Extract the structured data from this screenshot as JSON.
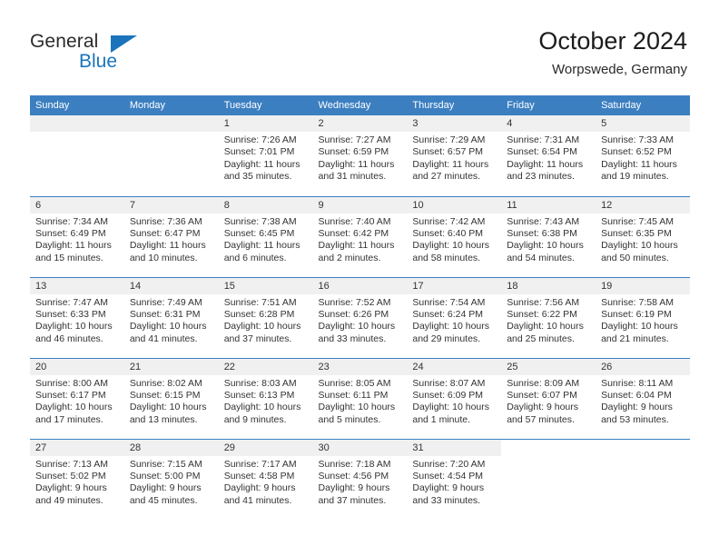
{
  "brand": {
    "name_part1": "General",
    "name_part2": "Blue",
    "logo_icon": "triangle-flag-icon",
    "accent_color": "#1b74bb"
  },
  "header": {
    "title": "October 2024",
    "location": "Worpswede, Germany"
  },
  "calendar": {
    "header_bg": "#3c7fc1",
    "daynum_bg": "#f0f0f0",
    "weekdays": [
      "Sunday",
      "Monday",
      "Tuesday",
      "Wednesday",
      "Thursday",
      "Friday",
      "Saturday"
    ],
    "weeks": [
      [
        {
          "day": "",
          "empty": true,
          "sunrise": "",
          "sunset": "",
          "daylight_l1": "",
          "daylight_l2": ""
        },
        {
          "day": "",
          "empty": true,
          "sunrise": "",
          "sunset": "",
          "daylight_l1": "",
          "daylight_l2": ""
        },
        {
          "day": "1",
          "sunrise": "Sunrise: 7:26 AM",
          "sunset": "Sunset: 7:01 PM",
          "daylight_l1": "Daylight: 11 hours",
          "daylight_l2": "and 35 minutes."
        },
        {
          "day": "2",
          "sunrise": "Sunrise: 7:27 AM",
          "sunset": "Sunset: 6:59 PM",
          "daylight_l1": "Daylight: 11 hours",
          "daylight_l2": "and 31 minutes."
        },
        {
          "day": "3",
          "sunrise": "Sunrise: 7:29 AM",
          "sunset": "Sunset: 6:57 PM",
          "daylight_l1": "Daylight: 11 hours",
          "daylight_l2": "and 27 minutes."
        },
        {
          "day": "4",
          "sunrise": "Sunrise: 7:31 AM",
          "sunset": "Sunset: 6:54 PM",
          "daylight_l1": "Daylight: 11 hours",
          "daylight_l2": "and 23 minutes."
        },
        {
          "day": "5",
          "sunrise": "Sunrise: 7:33 AM",
          "sunset": "Sunset: 6:52 PM",
          "daylight_l1": "Daylight: 11 hours",
          "daylight_l2": "and 19 minutes."
        }
      ],
      [
        {
          "day": "6",
          "sunrise": "Sunrise: 7:34 AM",
          "sunset": "Sunset: 6:49 PM",
          "daylight_l1": "Daylight: 11 hours",
          "daylight_l2": "and 15 minutes."
        },
        {
          "day": "7",
          "sunrise": "Sunrise: 7:36 AM",
          "sunset": "Sunset: 6:47 PM",
          "daylight_l1": "Daylight: 11 hours",
          "daylight_l2": "and 10 minutes."
        },
        {
          "day": "8",
          "sunrise": "Sunrise: 7:38 AM",
          "sunset": "Sunset: 6:45 PM",
          "daylight_l1": "Daylight: 11 hours",
          "daylight_l2": "and 6 minutes."
        },
        {
          "day": "9",
          "sunrise": "Sunrise: 7:40 AM",
          "sunset": "Sunset: 6:42 PM",
          "daylight_l1": "Daylight: 11 hours",
          "daylight_l2": "and 2 minutes."
        },
        {
          "day": "10",
          "sunrise": "Sunrise: 7:42 AM",
          "sunset": "Sunset: 6:40 PM",
          "daylight_l1": "Daylight: 10 hours",
          "daylight_l2": "and 58 minutes."
        },
        {
          "day": "11",
          "sunrise": "Sunrise: 7:43 AM",
          "sunset": "Sunset: 6:38 PM",
          "daylight_l1": "Daylight: 10 hours",
          "daylight_l2": "and 54 minutes."
        },
        {
          "day": "12",
          "sunrise": "Sunrise: 7:45 AM",
          "sunset": "Sunset: 6:35 PM",
          "daylight_l1": "Daylight: 10 hours",
          "daylight_l2": "and 50 minutes."
        }
      ],
      [
        {
          "day": "13",
          "sunrise": "Sunrise: 7:47 AM",
          "sunset": "Sunset: 6:33 PM",
          "daylight_l1": "Daylight: 10 hours",
          "daylight_l2": "and 46 minutes."
        },
        {
          "day": "14",
          "sunrise": "Sunrise: 7:49 AM",
          "sunset": "Sunset: 6:31 PM",
          "daylight_l1": "Daylight: 10 hours",
          "daylight_l2": "and 41 minutes."
        },
        {
          "day": "15",
          "sunrise": "Sunrise: 7:51 AM",
          "sunset": "Sunset: 6:28 PM",
          "daylight_l1": "Daylight: 10 hours",
          "daylight_l2": "and 37 minutes."
        },
        {
          "day": "16",
          "sunrise": "Sunrise: 7:52 AM",
          "sunset": "Sunset: 6:26 PM",
          "daylight_l1": "Daylight: 10 hours",
          "daylight_l2": "and 33 minutes."
        },
        {
          "day": "17",
          "sunrise": "Sunrise: 7:54 AM",
          "sunset": "Sunset: 6:24 PM",
          "daylight_l1": "Daylight: 10 hours",
          "daylight_l2": "and 29 minutes."
        },
        {
          "day": "18",
          "sunrise": "Sunrise: 7:56 AM",
          "sunset": "Sunset: 6:22 PM",
          "daylight_l1": "Daylight: 10 hours",
          "daylight_l2": "and 25 minutes."
        },
        {
          "day": "19",
          "sunrise": "Sunrise: 7:58 AM",
          "sunset": "Sunset: 6:19 PM",
          "daylight_l1": "Daylight: 10 hours",
          "daylight_l2": "and 21 minutes."
        }
      ],
      [
        {
          "day": "20",
          "sunrise": "Sunrise: 8:00 AM",
          "sunset": "Sunset: 6:17 PM",
          "daylight_l1": "Daylight: 10 hours",
          "daylight_l2": "and 17 minutes."
        },
        {
          "day": "21",
          "sunrise": "Sunrise: 8:02 AM",
          "sunset": "Sunset: 6:15 PM",
          "daylight_l1": "Daylight: 10 hours",
          "daylight_l2": "and 13 minutes."
        },
        {
          "day": "22",
          "sunrise": "Sunrise: 8:03 AM",
          "sunset": "Sunset: 6:13 PM",
          "daylight_l1": "Daylight: 10 hours",
          "daylight_l2": "and 9 minutes."
        },
        {
          "day": "23",
          "sunrise": "Sunrise: 8:05 AM",
          "sunset": "Sunset: 6:11 PM",
          "daylight_l1": "Daylight: 10 hours",
          "daylight_l2": "and 5 minutes."
        },
        {
          "day": "24",
          "sunrise": "Sunrise: 8:07 AM",
          "sunset": "Sunset: 6:09 PM",
          "daylight_l1": "Daylight: 10 hours",
          "daylight_l2": "and 1 minute."
        },
        {
          "day": "25",
          "sunrise": "Sunrise: 8:09 AM",
          "sunset": "Sunset: 6:07 PM",
          "daylight_l1": "Daylight: 9 hours",
          "daylight_l2": "and 57 minutes."
        },
        {
          "day": "26",
          "sunrise": "Sunrise: 8:11 AM",
          "sunset": "Sunset: 6:04 PM",
          "daylight_l1": "Daylight: 9 hours",
          "daylight_l2": "and 53 minutes."
        }
      ],
      [
        {
          "day": "27",
          "sunrise": "Sunrise: 7:13 AM",
          "sunset": "Sunset: 5:02 PM",
          "daylight_l1": "Daylight: 9 hours",
          "daylight_l2": "and 49 minutes."
        },
        {
          "day": "28",
          "sunrise": "Sunrise: 7:15 AM",
          "sunset": "Sunset: 5:00 PM",
          "daylight_l1": "Daylight: 9 hours",
          "daylight_l2": "and 45 minutes."
        },
        {
          "day": "29",
          "sunrise": "Sunrise: 7:17 AM",
          "sunset": "Sunset: 4:58 PM",
          "daylight_l1": "Daylight: 9 hours",
          "daylight_l2": "and 41 minutes."
        },
        {
          "day": "30",
          "sunrise": "Sunrise: 7:18 AM",
          "sunset": "Sunset: 4:56 PM",
          "daylight_l1": "Daylight: 9 hours",
          "daylight_l2": "and 37 minutes."
        },
        {
          "day": "31",
          "sunrise": "Sunrise: 7:20 AM",
          "sunset": "Sunset: 4:54 PM",
          "daylight_l1": "Daylight: 9 hours",
          "daylight_l2": "and 33 minutes."
        },
        {
          "day": "",
          "blank": true,
          "sunrise": "",
          "sunset": "",
          "daylight_l1": "",
          "daylight_l2": ""
        },
        {
          "day": "",
          "blank": true,
          "sunrise": "",
          "sunset": "",
          "daylight_l1": "",
          "daylight_l2": ""
        }
      ]
    ]
  }
}
